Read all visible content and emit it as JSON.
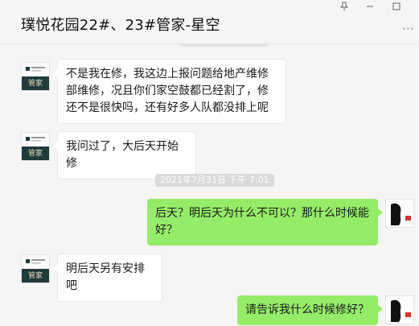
{
  "window": {
    "title": "璞悦花园22#、23#管家-星空",
    "pin_icon": "pin-icon",
    "minimize_icon": "minimize-icon",
    "maximize_icon": "maximize-icon",
    "more_icon": "more-icon"
  },
  "avatars": {
    "manager_label": "管家"
  },
  "messages": [
    {
      "side": "in",
      "text": "不是我在修，我这边上报问题给地产维修部维修，况且你们家空鼓都已经割了，修还不是很快吗，还有好多人队都没排上呢"
    },
    {
      "side": "in",
      "text": "我问过了，大后天开始修"
    },
    {
      "side": "out",
      "text": "后天？明后天为什么不可以？那什么时候能好？"
    },
    {
      "side": "in",
      "text": "明后天另有安排吧"
    },
    {
      "side": "out",
      "text": "请告诉我什么时候修好？"
    }
  ],
  "timestamps": [
    {
      "text": "2021年7月31日 下午 7:01"
    }
  ],
  "colors": {
    "outgoing_bubble": "#95ec69",
    "incoming_bubble": "#ffffff",
    "avatar_green": "#1f3b3a"
  }
}
